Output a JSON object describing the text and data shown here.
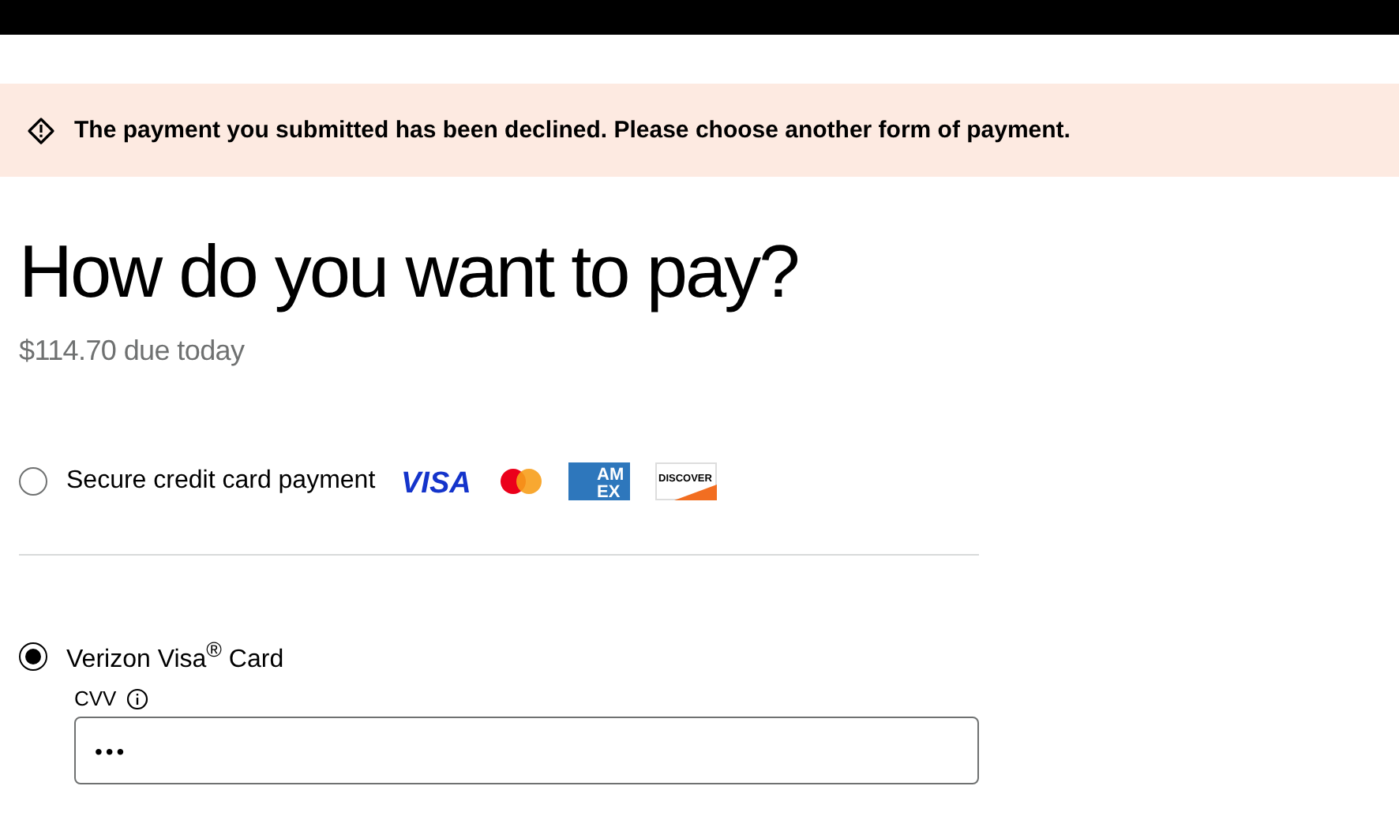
{
  "alert": {
    "message": "The payment you submitted has been declined. Please choose another form of payment."
  },
  "heading": "How do you want to pay?",
  "amount_due": "$114.70 due today",
  "payment_options": [
    {
      "label": "Secure credit card payment",
      "selected": false,
      "card_logos": [
        {
          "kind": "visa",
          "label": "VISA"
        },
        {
          "kind": "mastercard"
        },
        {
          "kind": "amex",
          "label": "AM",
          "label_2": "EX"
        },
        {
          "kind": "discover",
          "label": "DISCOVER"
        }
      ]
    },
    {
      "label": "Verizon Visa$^{®}$ Card",
      "selected": true,
      "cvv": {
        "label": "CVV",
        "value": "•••"
      }
    }
  ]
}
